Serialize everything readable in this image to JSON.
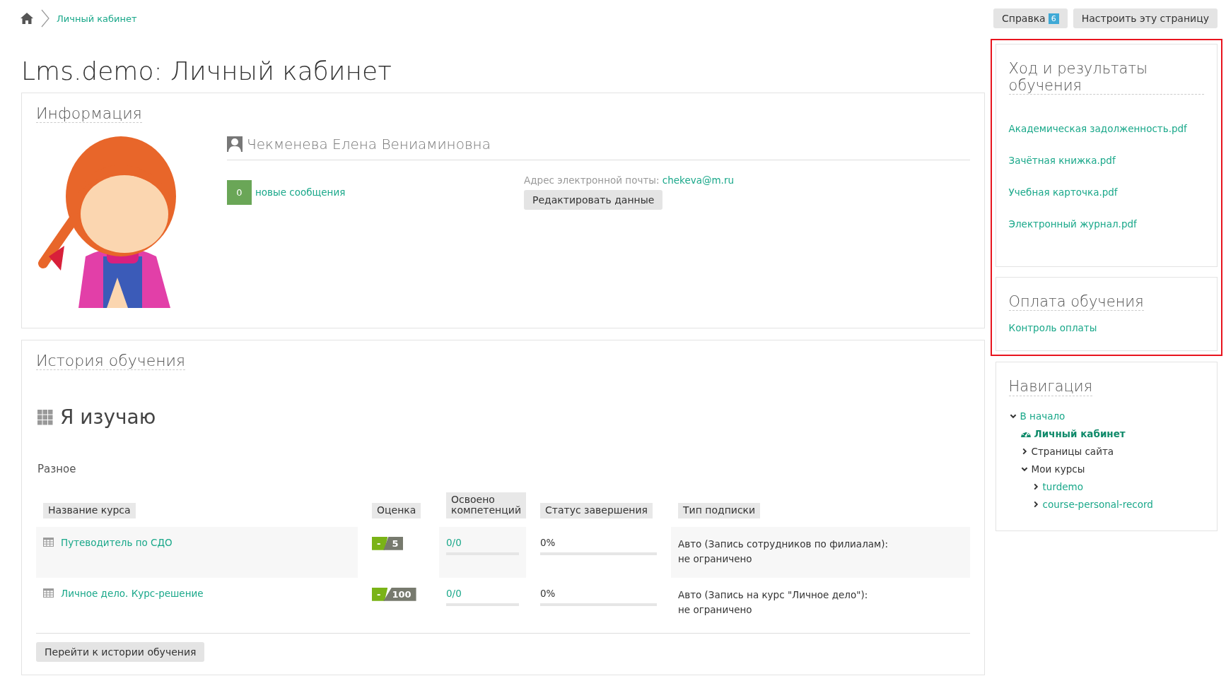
{
  "breadcrumb": [
    {
      "label": "Личный кабинет"
    }
  ],
  "header_buttons": [
    {
      "label": "Справка",
      "badge": "6"
    },
    {
      "label": "Настроить эту страницу"
    }
  ],
  "page_title": "Lms.demo: Личный кабинет",
  "info": {
    "title": "Информация",
    "user_name": "Чекменева Елена Вениаминовна",
    "messages_count": "0",
    "messages_label": "новые сообщения",
    "email_label": "Адрес электронной почты:",
    "email": "chekeva@m.ru",
    "edit_button": "Редактировать данные"
  },
  "history": {
    "title": "История обучения",
    "subtitle": "Я изучаю",
    "group": "Разное",
    "columns": [
      "Название курса",
      "Оценка",
      "Освоено компетенций",
      "Статус завершения",
      "Тип подписки"
    ],
    "rows": [
      {
        "course": "Путеводитель по СДО",
        "grade_mark": "-",
        "grade": "5",
        "competencies": {
          "label": "0/0",
          "level": 0
        },
        "status": {
          "label": "0%",
          "level": 0
        },
        "subscription": "Авто (Запись сотрудников по филиалам):",
        "limit": "не ограничено"
      },
      {
        "course": "Личное дело. Курс-решение",
        "grade_mark": "-",
        "grade": "100",
        "competencies": {
          "label": "0/0",
          "level": 0
        },
        "status": {
          "label": "0%",
          "level": 0
        },
        "subscription": "Авто (Запись на курс \"Личное дело\"):",
        "limit": "не ограничено"
      }
    ],
    "history_button": "Перейти к истории обучения"
  },
  "sidebar": {
    "groups": [
      {
        "highlight": true,
        "blocks": [
          {
            "kind": "links",
            "title": "Ход и результаты обучения",
            "links": [
              "Академическая задолженность.pdf",
              "Зачётная книжка.pdf",
              "Учебная карточка.pdf",
              "Электронный журнал.pdf"
            ]
          },
          {
            "kind": "links",
            "title": "Оплата обучения",
            "links": [
              "Контроль оплаты"
            ]
          }
        ]
      },
      {
        "highlight": false,
        "blocks": [
          {
            "kind": "tree",
            "title": "Навигация",
            "items": [
              {
                "label": "В начало",
                "kind": "link",
                "expanded": true,
                "children": [
                  {
                    "label": "Личный кабинет",
                    "kind": "current"
                  },
                  {
                    "label": "Страницы сайта",
                    "kind": "text",
                    "expanded": false
                  },
                  {
                    "label": "Мои курсы",
                    "kind": "text",
                    "expanded": true,
                    "children": [
                      {
                        "label": "turdemo",
                        "kind": "link",
                        "expanded": false
                      },
                      {
                        "label": "course-personal-record",
                        "kind": "link",
                        "expanded": false
                      }
                    ]
                  }
                ]
              }
            ]
          }
        ]
      }
    ]
  }
}
